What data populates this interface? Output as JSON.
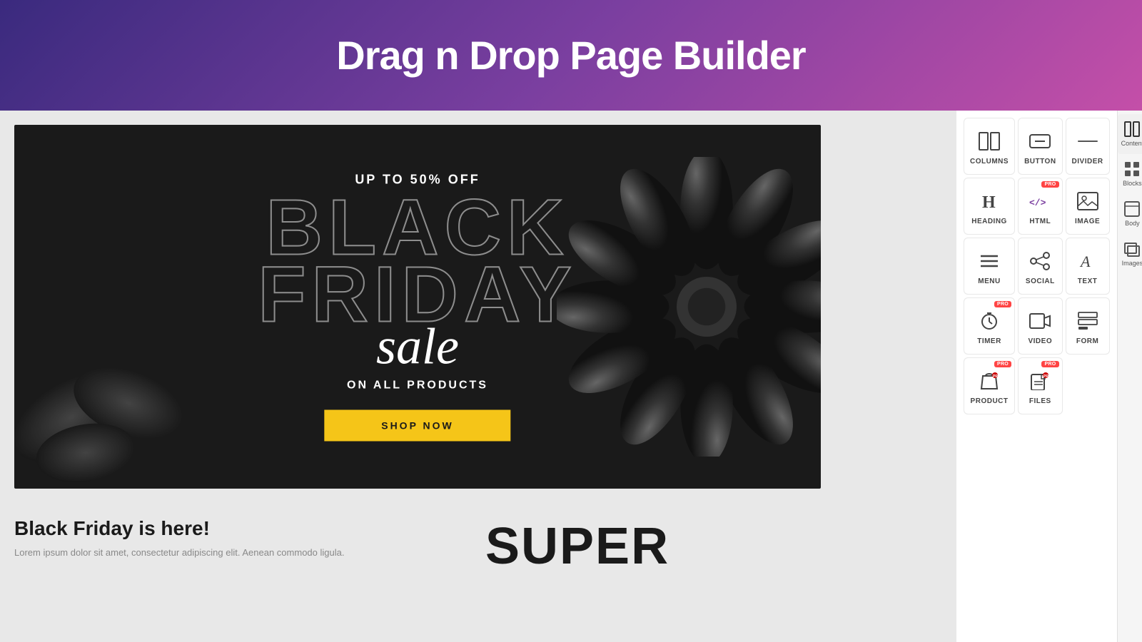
{
  "header": {
    "title": "Drag n Drop Page Builder",
    "gradient_start": "#3a2a7e",
    "gradient_end": "#c44fa8"
  },
  "banner": {
    "subtitle": "UP TO 50% OFF",
    "title_line1": "BLACK",
    "title_line2": "FRIDAY",
    "title_sale": "sale",
    "products_text": "ON ALL PRODUCTS",
    "shop_button": "SHOP NOW"
  },
  "below_banner": {
    "heading": "Black Friday is here!",
    "paragraph": "Lorem ipsum dolor sit amet, consectetur adipiscing elit. Aenean commodo ligula.",
    "super_text": "SUPER"
  },
  "sidebar": {
    "right_tabs": [
      {
        "label": "Content",
        "icon": "grid-icon"
      },
      {
        "label": "Blocks",
        "icon": "blocks-icon"
      },
      {
        "label": "Body",
        "icon": "body-icon"
      },
      {
        "label": "Images",
        "icon": "images-icon"
      }
    ],
    "elements": [
      {
        "label": "COLUMNS",
        "icon": "columns-icon",
        "pro": false
      },
      {
        "label": "BUTTON",
        "icon": "button-icon",
        "pro": false
      },
      {
        "label": "DIVIDER",
        "icon": "divider-icon",
        "pro": false
      },
      {
        "label": "HEADING",
        "icon": "heading-icon",
        "pro": false
      },
      {
        "label": "HTML",
        "icon": "html-icon",
        "pro": true
      },
      {
        "label": "IMAGE",
        "icon": "image-icon",
        "pro": false
      },
      {
        "label": "MENU",
        "icon": "menu-icon",
        "pro": false
      },
      {
        "label": "SOCIAL",
        "icon": "social-icon",
        "pro": false
      },
      {
        "label": "TEXT",
        "icon": "text-icon",
        "pro": false
      },
      {
        "label": "TIMER",
        "icon": "timer-icon",
        "pro": true
      },
      {
        "label": "VIDEO",
        "icon": "video-icon",
        "pro": false
      },
      {
        "label": "FORM",
        "icon": "form-icon",
        "pro": false
      },
      {
        "label": "PRODUCT",
        "icon": "product-icon",
        "pro": true
      },
      {
        "label": "FILES",
        "icon": "files-icon",
        "pro": true
      }
    ]
  }
}
